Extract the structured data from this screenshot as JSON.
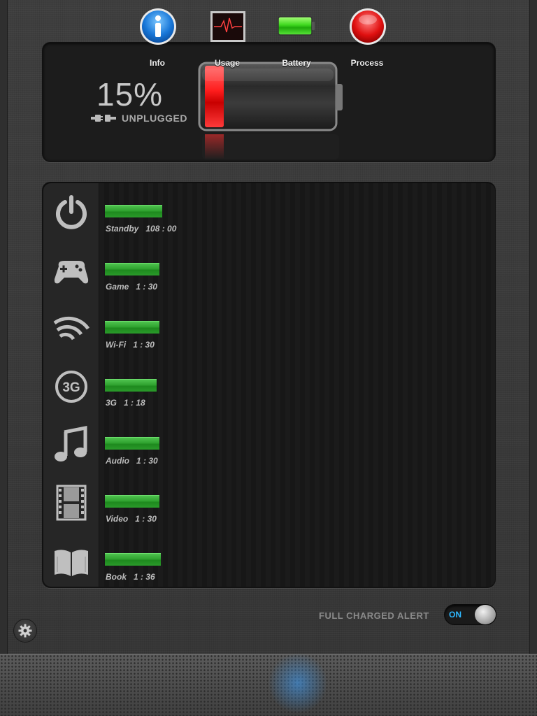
{
  "battery": {
    "percent_text": "15%",
    "level": 0.15,
    "status": "UNPLUGGED",
    "fill_color": "#ff2a2a"
  },
  "usage": {
    "bar_color": "#2fa22f",
    "rows": [
      {
        "icon": "power-icon",
        "label": "Standby   108 : 00",
        "minutes": 6480,
        "bar_fill": 0.145
      },
      {
        "icon": "gamepad-icon",
        "label": "Game   1 : 30",
        "minutes": 90,
        "bar_fill": 0.138
      },
      {
        "icon": "wifi-icon",
        "label": "Wi-Fi   1 : 30",
        "minutes": 90,
        "bar_fill": 0.138
      },
      {
        "icon": "3g-icon",
        "icon_text": "3G",
        "label": "3G   1 : 18",
        "minutes": 78,
        "bar_fill": 0.131
      },
      {
        "icon": "music-note-icon",
        "label": "Audio   1 : 30",
        "minutes": 90,
        "bar_fill": 0.138
      },
      {
        "icon": "film-icon",
        "label": "Video   1 : 30",
        "minutes": 90,
        "bar_fill": 0.138
      },
      {
        "icon": "book-icon",
        "label": "Book   1 : 36",
        "minutes": 96,
        "bar_fill": 0.142
      }
    ]
  },
  "alert": {
    "label": "FULL CHARGED ALERT",
    "toggle_text": "ON",
    "enabled": true,
    "accent_color": "#2eb8ff"
  },
  "settings": {
    "icon": "gear-icon"
  },
  "tabs": [
    {
      "label": "Info",
      "icon": "info-icon",
      "active": false
    },
    {
      "label": "Usage",
      "icon": "heart-monitor-icon",
      "active": false
    },
    {
      "label": "Battery",
      "icon": "battery-icon",
      "active": true
    },
    {
      "label": "Process",
      "icon": "red-circle-icon",
      "active": false
    }
  ]
}
